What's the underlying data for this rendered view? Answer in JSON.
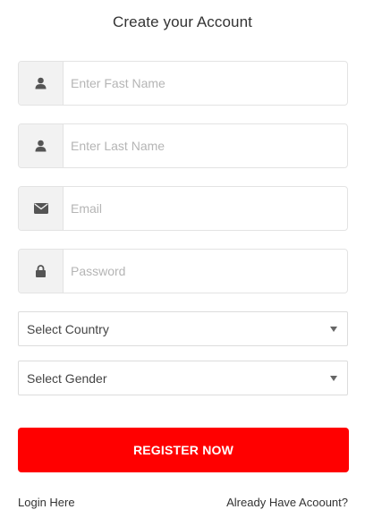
{
  "title": "Create your Account",
  "fields": {
    "first_name": {
      "placeholder": "Enter Fast Name",
      "icon": "user-icon"
    },
    "last_name": {
      "placeholder": "Enter Last Name",
      "icon": "user-icon"
    },
    "email": {
      "placeholder": "Email",
      "icon": "envelope-icon"
    },
    "password": {
      "placeholder": "Password",
      "icon": "lock-icon"
    }
  },
  "selects": {
    "country": {
      "selected": "Select Country"
    },
    "gender": {
      "selected": "Select Gender"
    }
  },
  "register_label": "REGISTER NOW",
  "links": {
    "login": "Login Here",
    "already": "Already Have Acoount?"
  },
  "colors": {
    "accent": "#ff0000",
    "addon_bg": "#f2f2f2",
    "border": "#e3e3e3"
  }
}
